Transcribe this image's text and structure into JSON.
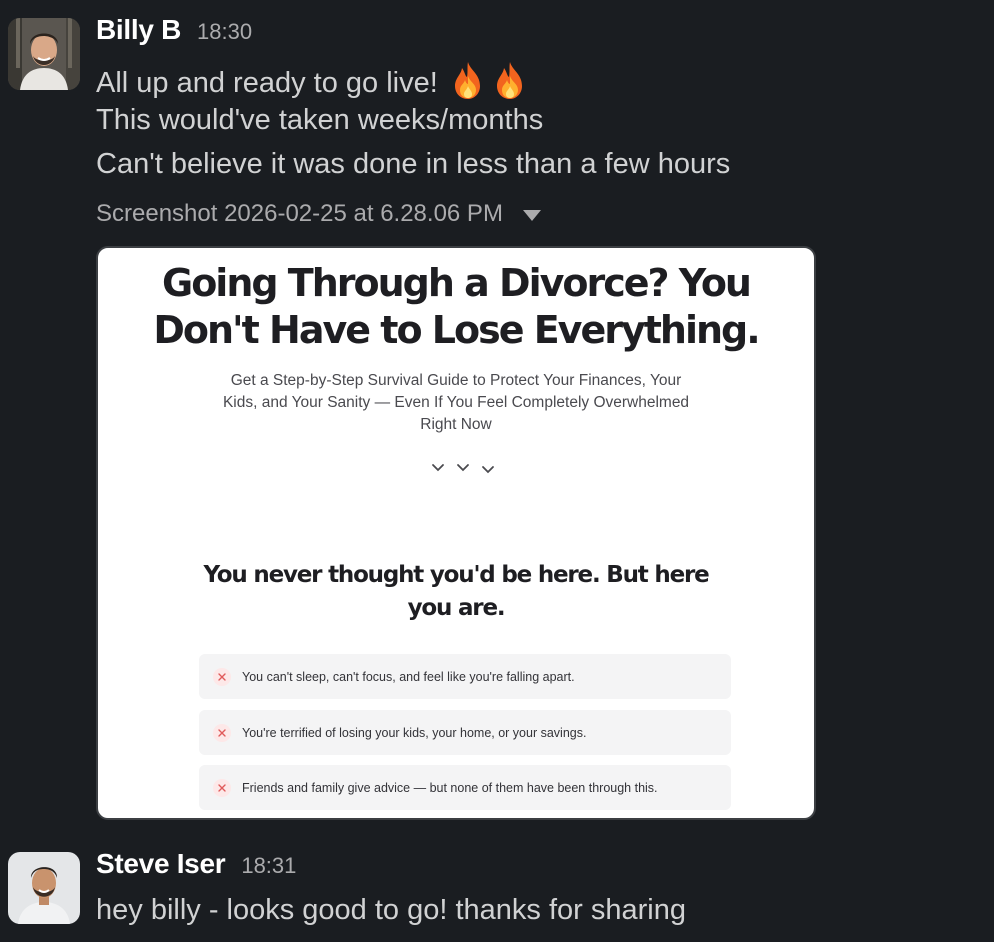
{
  "messages": [
    {
      "author": "Billy B",
      "time": "18:30",
      "lines": [
        "All up and ready to go live!",
        "This would've taken weeks/months",
        "Can't believe it was done in less than a few hours"
      ],
      "emoji": [
        "fire-icon",
        "fire-icon"
      ],
      "attachment": {
        "file_name": "Screenshot 2026-02-25 at 6.28.06 PM",
        "preview": {
          "headline_line1": "Going Through a Divorce? You",
          "headline_line2": "Don't Have to Lose Everything.",
          "subheadline_line1": "Get a Step-by-Step Survival Guide to Protect Your Finances, Your",
          "subheadline_line2": "Kids, and Your Sanity — Even If You Feel Completely Overwhelmed",
          "subheadline_line3": "Right Now",
          "section_heading_line1": "You never thought you'd be here. But here",
          "section_heading_line2": "you are.",
          "pain_points": [
            "You can't sleep, can't focus, and feel like you're falling apart.",
            "You're terrified of losing your kids, your home, or your savings.",
            "Friends and family give advice — but none of them have been through this."
          ]
        }
      }
    },
    {
      "author": "Steve Iser",
      "time": "18:31",
      "lines": [
        "hey billy - looks good to go! thanks for sharing"
      ]
    }
  ],
  "colors": {
    "background": "#1a1d21",
    "author": "#ffffff",
    "body_text": "#d1d2d3",
    "muted": "#ababad",
    "x_badge": "#e05a5a"
  }
}
